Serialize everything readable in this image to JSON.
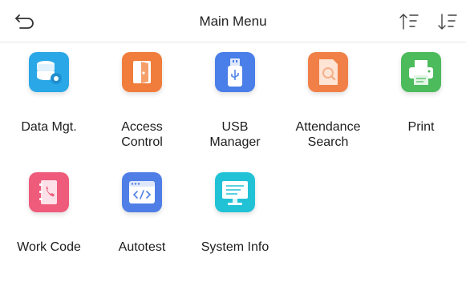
{
  "header": {
    "title": "Main Menu",
    "back_icon": "back-arrow-icon",
    "sort_asc_icon": "sort-ascending-icon",
    "sort_desc_icon": "sort-descending-icon"
  },
  "menu_items": [
    {
      "line1": "Data Mgt.",
      "line2": "",
      "icon": "database-settings-icon",
      "color": "#2aa7e6"
    },
    {
      "line1": "Access",
      "line2": "Control",
      "icon": "door-icon",
      "color": "#f07d3c"
    },
    {
      "line1": "USB",
      "line2": "Manager",
      "icon": "usb-drive-icon",
      "color": "#4a7ee8"
    },
    {
      "line1": "Attendance",
      "line2": "Search",
      "icon": "search-document-icon",
      "color": "#f18048"
    },
    {
      "line1": "Print",
      "line2": "",
      "icon": "printer-icon",
      "color": "#4cbb5c"
    },
    {
      "line1": "Work Code",
      "line2": "",
      "icon": "phone-book-icon",
      "color": "#ee5b7b"
    },
    {
      "line1": "Autotest",
      "line2": "",
      "icon": "code-window-icon",
      "color": "#4f7fe6"
    },
    {
      "line1": "System Info",
      "line2": "",
      "icon": "monitor-icon",
      "color": "#22c2d6"
    }
  ]
}
